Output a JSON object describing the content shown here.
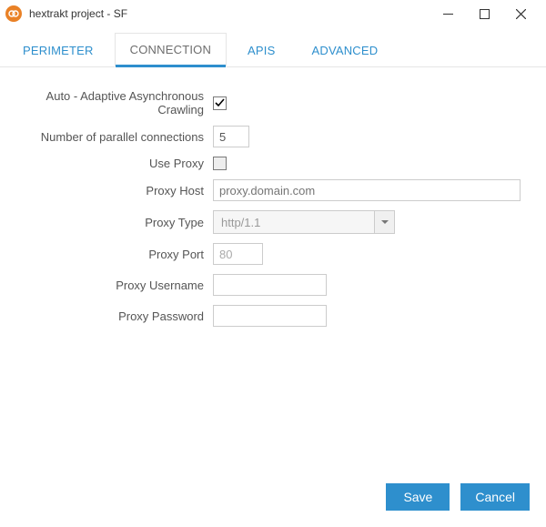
{
  "window": {
    "title": "hextrakt project - SF"
  },
  "tabs": [
    {
      "id": "perimeter",
      "label": "PERIMETER",
      "active": false
    },
    {
      "id": "connection",
      "label": "CONNECTION",
      "active": true
    },
    {
      "id": "apis",
      "label": "APIS",
      "active": false
    },
    {
      "id": "advanced",
      "label": "ADVANCED",
      "active": false
    }
  ],
  "form": {
    "auto_adaptive": {
      "label": "Auto - Adaptive Asynchronous Crawling",
      "checked": true
    },
    "parallel": {
      "label": "Number of parallel connections",
      "value": "5"
    },
    "use_proxy": {
      "label": "Use Proxy",
      "checked": false
    },
    "proxy_host": {
      "label": "Proxy Host",
      "placeholder": "proxy.domain.com",
      "value": ""
    },
    "proxy_type": {
      "label": "Proxy Type",
      "value": "http/1.1"
    },
    "proxy_port": {
      "label": "Proxy Port",
      "value": "80"
    },
    "proxy_user": {
      "label": "Proxy Username",
      "value": ""
    },
    "proxy_pass": {
      "label": "Proxy Password",
      "value": ""
    }
  },
  "footer": {
    "save": "Save",
    "cancel": "Cancel"
  }
}
